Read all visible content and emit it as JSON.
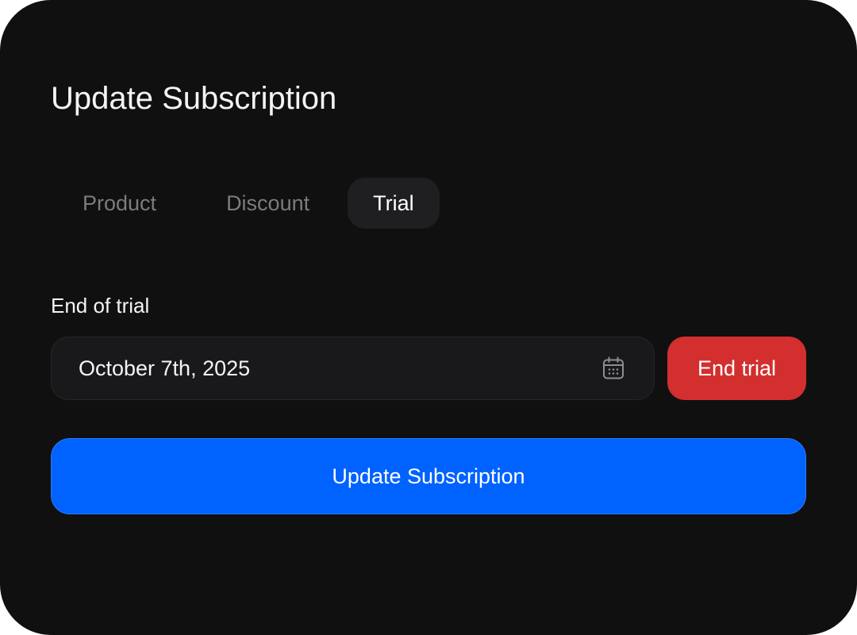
{
  "dialog": {
    "title": "Update Subscription"
  },
  "tabs": [
    {
      "label": "Product",
      "active": false
    },
    {
      "label": "Discount",
      "active": false
    },
    {
      "label": "Trial",
      "active": true
    }
  ],
  "trial": {
    "field_label": "End of trial",
    "date_value": "October 7th, 2025",
    "date_icon": "calendar-icon",
    "end_trial_label": "End trial"
  },
  "actions": {
    "submit_label": "Update Subscription"
  },
  "colors": {
    "background": "#101010",
    "tab_active_bg": "#1f1f22",
    "input_bg": "#19191b",
    "danger": "#d32f2f",
    "primary": "#0062ff",
    "muted_text": "#7b7b80"
  }
}
